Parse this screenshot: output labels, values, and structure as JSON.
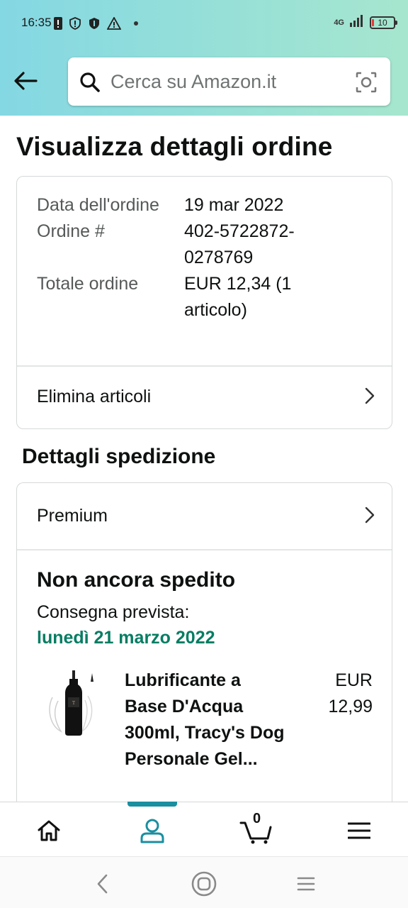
{
  "status_bar": {
    "time": "16:35",
    "network": "4G",
    "battery": "10"
  },
  "search": {
    "placeholder": "Cerca su Amazon.it"
  },
  "page": {
    "title": "Visualizza dettagli ordine"
  },
  "order_summary": {
    "rows": [
      {
        "label": "Data dell'ordine",
        "value": "19 mar 2022"
      },
      {
        "label": "Ordine #",
        "value": "402-5722872-0278769"
      },
      {
        "label": "Totale ordine",
        "value": "EUR 12,34 (1 articolo)"
      }
    ],
    "remove_items_label": "Elimina articoli"
  },
  "shipping": {
    "section_title": "Dettagli spedizione",
    "method": "Premium",
    "status": "Non ancora spedito",
    "delivery_label": "Consegna prevista:",
    "delivery_date": "lunedì 21 marzo 2022",
    "delivery_date_color": "#067d62",
    "item": {
      "name": "Lubrificante a Base D'Acqua 300ml, Tracy's Dog Personale Gel...",
      "price": "EUR 12,99"
    }
  },
  "bottom_nav": {
    "active": "account",
    "cart_count": "0",
    "accent_color": "#1a8fa0",
    "items": [
      "home-icon",
      "account-icon",
      "cart-icon",
      "menu-icon"
    ]
  }
}
